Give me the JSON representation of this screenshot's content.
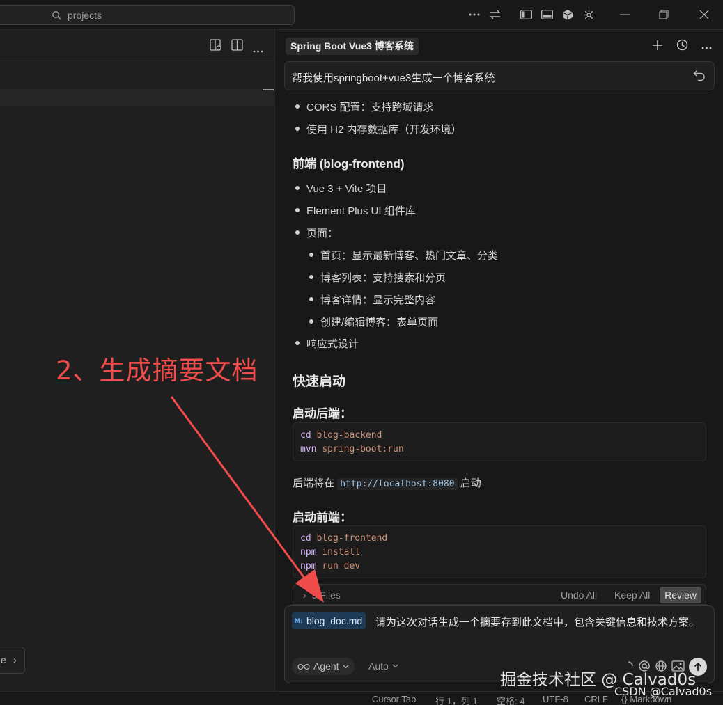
{
  "titlebar": {
    "search_placeholder": "projects",
    "icons": [
      "more-icon",
      "swap-icon",
      "sidebar-left-icon",
      "panel-bottom-icon",
      "cube-icon",
      "gear-icon",
      "minimize-icon",
      "restore-icon",
      "close-icon"
    ]
  },
  "editor": {
    "toolbar_icons": [
      "split-preview-icon",
      "split-editor-icon",
      "more-icon"
    ],
    "pill_text": "e",
    "pill_chevron": "›"
  },
  "chat": {
    "tab_title": "Spring Boot Vue3 博客系统",
    "header_icons": [
      "plus-icon",
      "history-icon",
      "more-icon"
    ],
    "user_message": "帮我使用springboot+vue3生成一个博客系统",
    "backend_items": [
      "CORS 配置：支持跨域请求",
      "使用 H2 内存数据库（开发环境）"
    ],
    "frontend_heading": "前端 (blog-frontend)",
    "frontend_items": [
      "Vue 3 + Vite 项目",
      "Element Plus UI 组件库",
      "页面："
    ],
    "pages_items": [
      "首页：显示最新博客、热门文章、分类",
      "博客列表：支持搜索和分页",
      "博客详情：显示完整内容",
      "创建/编辑博客：表单页面"
    ],
    "responsive_item": "响应式设计",
    "quickstart_heading": "快速启动",
    "backend_start_heading": "启动后端：",
    "backend_code": [
      {
        "cmd": "cd",
        "arg": "blog-backend"
      },
      {
        "cmd": "mvn",
        "arg": "spring-boot:run"
      }
    ],
    "backend_note_prefix": "后端将在",
    "backend_note_url": "http://localhost:8080",
    "backend_note_suffix": "启动",
    "frontend_start_heading": "启动前端：",
    "frontend_code": [
      {
        "cmd": "cd",
        "arg": "blog-frontend"
      },
      {
        "cmd": "npm",
        "arg": "install"
      },
      {
        "cmd": "npm",
        "arg": "run dev"
      }
    ],
    "files_count": "9 Files",
    "undo_all": "Undo All",
    "keep_all": "Keep All",
    "review": "Review",
    "attached_file": "blog_doc.md",
    "attached_badge": "M↓",
    "input_text": "请为这次对话生成一个摘要存到此文档中，包含关键信息和技术方案。",
    "agent_label": "Agent",
    "auto_label": "Auto"
  },
  "annotation": {
    "text": "2、生成摘要文档",
    "color": "#f04c4c"
  },
  "statusbar": {
    "cursor_tab": "Cursor Tab",
    "position": "行 1，列 1",
    "spaces": "空格: 4",
    "encoding": "UTF-8",
    "eol": "CRLF",
    "language": "Markdown"
  },
  "watermark": {
    "line1": "掘金技术社区 @ Calvad0s",
    "line2": "CSDN @Calvad0s"
  }
}
